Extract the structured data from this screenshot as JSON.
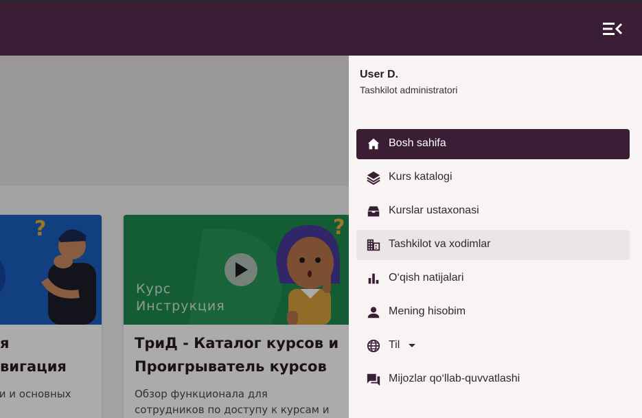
{
  "topbar": {
    "menu_icon": "menu-open-icon"
  },
  "background_cards": [
    {
      "title": "я\nвигация",
      "description": "ти и основных"
    },
    {
      "thumbnail_label_line1": "Курс",
      "thumbnail_label_line2": "Инструкция",
      "title": "ТриД - Каталог курсов и Проигрыватель курсов",
      "description": "Обзор функционала для сотрудников по доступу к курсам и прохождению"
    }
  ],
  "drawer": {
    "user_name": "User D.",
    "user_role": "Tashkilot administratori",
    "nav": [
      {
        "icon": "home-icon",
        "label": "Bosh sahifa",
        "active": true
      },
      {
        "icon": "layers-icon",
        "label": "Kurs katalogi"
      },
      {
        "icon": "inbox-tray-icon",
        "label": "Kurslar ustaxonasi"
      },
      {
        "icon": "building-icon",
        "label": "Tashkilot va xodimlar",
        "hovered": true
      },
      {
        "icon": "bar-chart-icon",
        "label": "O‘qish natijalari"
      },
      {
        "icon": "person-icon",
        "label": "Mening hisobim"
      },
      {
        "icon": "globe-icon",
        "label": "Til"
      },
      {
        "icon": "chat-icon",
        "label": "Mijozlar qo‘llab-quvvatlashi"
      }
    ]
  },
  "colors": {
    "brand": "#3a1e35",
    "drawer_bg": "#f8f4f4",
    "hover_bg": "#ebe6e6",
    "card_green": "#1f8a4c",
    "card_blue": "#1b5fbf"
  }
}
